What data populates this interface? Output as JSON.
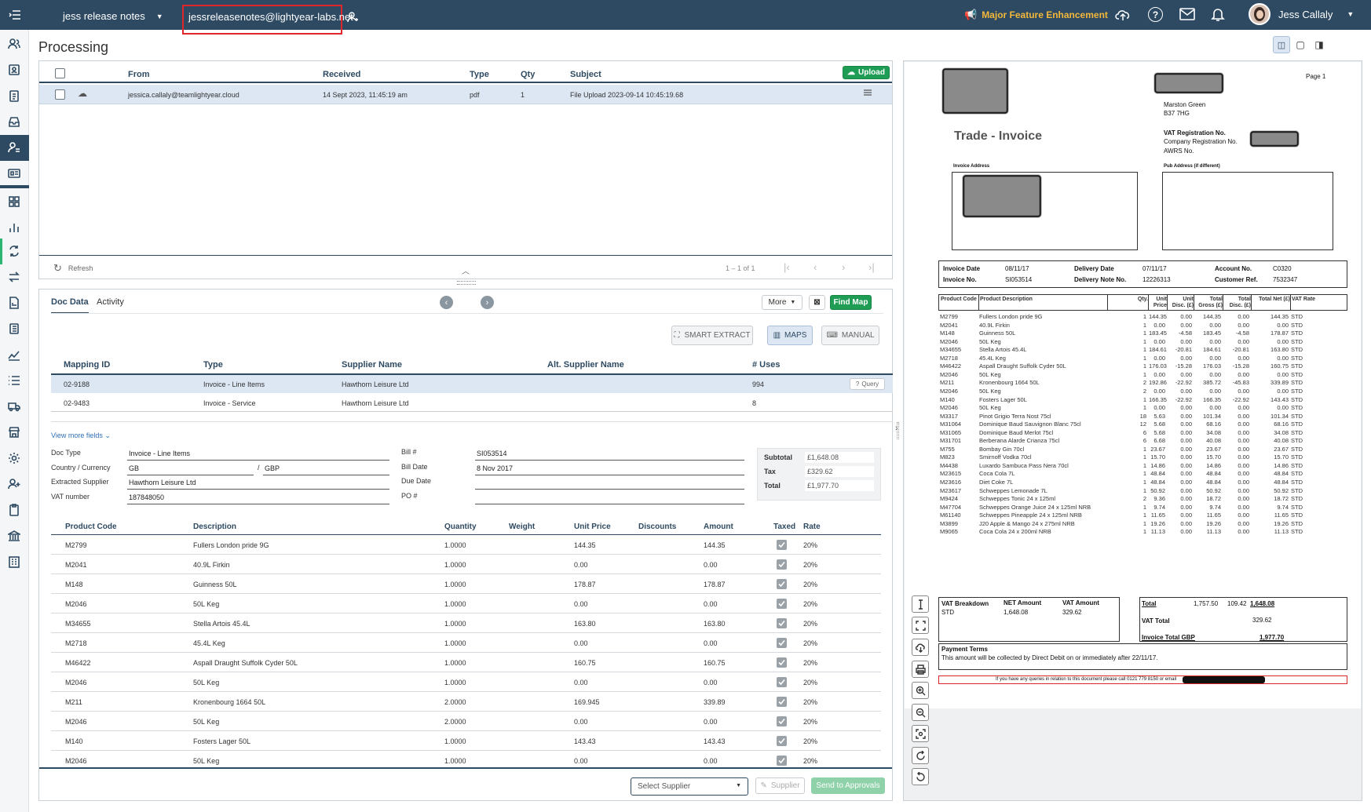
{
  "topbar": {
    "workspace": "jess release notes",
    "email": "jessreleasenotes@lightyear-labs.net",
    "feature": "Major Feature Enhancement",
    "user": "Jess Callaly"
  },
  "page_title": "Processing",
  "inbox": {
    "headers": {
      "from": "From",
      "received": "Received",
      "type": "Type",
      "qty": "Qty",
      "subject": "Subject"
    },
    "upload_label": "Upload",
    "row": {
      "from": "jessica.callaly@teamlightyear.cloud",
      "received": "14 Sept 2023, 11:45:19 am",
      "type": "pdf",
      "qty": "1",
      "subject": "File Upload 2023-09-14 10:45:19.68"
    },
    "refresh": "Refresh",
    "paging": "1 – 1 of 1"
  },
  "tabs": {
    "doc_data": "Doc Data",
    "activity": "Activity"
  },
  "buttons": {
    "more": "More",
    "find_map": "Find Map",
    "smart_extract": "SMART EXTRACT",
    "maps": "MAPS",
    "manual": "MANUAL",
    "query": "Query",
    "view_more": "View more fields",
    "select_supplier": "Select Supplier",
    "supplier": "Supplier",
    "send": "Send to Approvals"
  },
  "mapping": {
    "headers": {
      "id": "Mapping ID",
      "type": "Type",
      "supplier": "Supplier Name",
      "alt": "Alt. Supplier Name",
      "uses": "# Uses"
    },
    "rows": [
      {
        "id": "02-9188",
        "type": "Invoice - Line Items",
        "supplier": "Hawthorn Leisure Ltd",
        "alt": "",
        "uses": "994"
      },
      {
        "id": "02-9483",
        "type": "Invoice - Service",
        "supplier": "Hawthorn Leisure Ltd",
        "alt": "",
        "uses": "8"
      }
    ]
  },
  "fields": {
    "doc_type_label": "Doc Type",
    "doc_type": "Invoice - Line Items",
    "country_label": "Country / Currency",
    "country": "GB",
    "slash": "/",
    "currency": "GBP",
    "supplier_label": "Extracted Supplier",
    "supplier": "Hawthorn Leisure Ltd",
    "vat_label": "VAT number",
    "vat": "187848050",
    "bill_no_label": "Bill #",
    "bill_no": "SI053514",
    "bill_date_label": "Bill Date",
    "bill_date": "8 Nov 2017",
    "due_label": "Due Date",
    "due": "",
    "po_label": "PO #",
    "po": "",
    "subtotal_label": "Subtotal",
    "subtotal": "£1,648.08",
    "tax_label": "Tax",
    "tax": "£329.62",
    "total_label": "Total",
    "total": "£1,977.70"
  },
  "lines": {
    "headers": {
      "code": "Product Code",
      "desc": "Description",
      "qty": "Quantity",
      "weight": "Weight",
      "price": "Unit Price",
      "disc": "Discounts",
      "amount": "Amount",
      "taxed": "Taxed",
      "rate": "Rate"
    },
    "rows": [
      {
        "code": "M2799",
        "desc": "Fullers London pride 9G",
        "qty": "1.0000",
        "price": "144.35",
        "amount": "144.35",
        "rate": "20%"
      },
      {
        "code": "M2041",
        "desc": "40.9L Firkin",
        "qty": "1.0000",
        "price": "0.00",
        "amount": "0.00",
        "rate": "20%"
      },
      {
        "code": "M148",
        "desc": "Guinness 50L",
        "qty": "1.0000",
        "price": "178.87",
        "amount": "178.87",
        "rate": "20%"
      },
      {
        "code": "M2046",
        "desc": "50L Keg",
        "qty": "1.0000",
        "price": "0.00",
        "amount": "0.00",
        "rate": "20%"
      },
      {
        "code": "M34655",
        "desc": "Stella Artois 45.4L",
        "qty": "1.0000",
        "price": "163.80",
        "amount": "163.80",
        "rate": "20%"
      },
      {
        "code": "M2718",
        "desc": "45.4L Keg",
        "qty": "1.0000",
        "price": "0.00",
        "amount": "0.00",
        "rate": "20%"
      },
      {
        "code": "M46422",
        "desc": "Aspall Draught Suffolk Cyder 50L",
        "qty": "1.0000",
        "price": "160.75",
        "amount": "160.75",
        "rate": "20%"
      },
      {
        "code": "M2046",
        "desc": "50L Keg",
        "qty": "1.0000",
        "price": "0.00",
        "amount": "0.00",
        "rate": "20%"
      },
      {
        "code": "M211",
        "desc": "Kronenbourg 1664 50L",
        "qty": "2.0000",
        "price": "169.945",
        "amount": "339.89",
        "rate": "20%"
      },
      {
        "code": "M2046",
        "desc": "50L Keg",
        "qty": "2.0000",
        "price": "0.00",
        "amount": "0.00",
        "rate": "20%"
      },
      {
        "code": "M140",
        "desc": "Fosters Lager 50L",
        "qty": "1.0000",
        "price": "143.43",
        "amount": "143.43",
        "rate": "20%"
      },
      {
        "code": "M2046",
        "desc": "50L Keg",
        "qty": "1.0000",
        "price": "0.00",
        "amount": "0.00",
        "rate": "20%"
      }
    ]
  },
  "invoice": {
    "page": "Page  1",
    "addr1": "Marston Green",
    "addr2": "B37 7HG",
    "title": "Trade - Invoice",
    "vat_reg": "VAT Registration No.",
    "company_reg": "Company Registration No.",
    "awrs": "AWRS No.",
    "invoice_address": "Invoice Address",
    "pub_address": "Pub Address (if different)",
    "meta": {
      "inv_date_l": "Invoice Date",
      "inv_date": "08/11/17",
      "deliv_date_l": "Delivery Date",
      "deliv_date": "07/11/17",
      "acct_l": "Account No.",
      "acct": "C0320",
      "inv_no_l": "Invoice No.",
      "inv_no": "SI053514",
      "deliv_note_l": "Delivery Note No.",
      "deliv_note": "12226313",
      "cust_ref_l": "Customer Ref.",
      "cust_ref": "7532347"
    },
    "cols": [
      "Product Code",
      "Product Description",
      "Qty.",
      "Unit Price",
      "Unit Disc. (£)",
      "Total Gross (£)",
      "Total Disc. (£)",
      "Total Net (£)",
      "VAT Rate"
    ],
    "items": [
      [
        "M2799",
        "Fullers London pride 9G",
        "1",
        "144.35",
        "0.00",
        "144.35",
        "0.00",
        "144.35",
        "STD"
      ],
      [
        "M2041",
        "40.9L Firkin",
        "1",
        "0.00",
        "0.00",
        "0.00",
        "0.00",
        "0.00",
        "STD"
      ],
      [
        "M148",
        "Guinness  50L",
        "1",
        "183.45",
        "-4.58",
        "183.45",
        "-4.58",
        "178.87",
        "STD"
      ],
      [
        "M2046",
        "50L Keg",
        "1",
        "0.00",
        "0.00",
        "0.00",
        "0.00",
        "0.00",
        "STD"
      ],
      [
        "M34655",
        "Stella Artois  45.4L",
        "1",
        "184.61",
        "-20.81",
        "184.61",
        "-20.81",
        "163.80",
        "STD"
      ],
      [
        "M2718",
        "45.4L Keg",
        "1",
        "0.00",
        "0.00",
        "0.00",
        "0.00",
        "0.00",
        "STD"
      ],
      [
        "M46422",
        "Aspall Draught Suffolk Cyder 50L",
        "1",
        "176.03",
        "-15.28",
        "176.03",
        "-15.28",
        "160.75",
        "STD"
      ],
      [
        "M2046",
        "50L Keg",
        "1",
        "0.00",
        "0.00",
        "0.00",
        "0.00",
        "0.00",
        "STD"
      ],
      [
        "M211",
        "Kronenbourg 1664  50L",
        "2",
        "192.86",
        "-22.92",
        "385.72",
        "-45.83",
        "339.89",
        "STD"
      ],
      [
        "M2046",
        "50L Keg",
        "2",
        "0.00",
        "0.00",
        "0.00",
        "0.00",
        "0.00",
        "STD"
      ],
      [
        "M140",
        "Fosters Lager  50L",
        "1",
        "166.35",
        "-22.92",
        "166.35",
        "-22.92",
        "143.43",
        "STD"
      ],
      [
        "M2046",
        "50L Keg",
        "1",
        "0.00",
        "0.00",
        "0.00",
        "0.00",
        "0.00",
        "STD"
      ],
      [
        "M3317",
        "Pinot Grigio Terra Nost  75cl",
        "18",
        "5.63",
        "0.00",
        "101.34",
        "0.00",
        "101.34",
        "STD"
      ],
      [
        "M31064",
        "Dominique Baud Sauvignon Blanc  75cl",
        "12",
        "5.68",
        "0.00",
        "68.16",
        "0.00",
        "68.16",
        "STD"
      ],
      [
        "M31065",
        "Dominique Baud Merlot  75cl",
        "6",
        "5.68",
        "0.00",
        "34.08",
        "0.00",
        "34.08",
        "STD"
      ],
      [
        "M31701",
        "Berberana Alarde Crianza  75cl",
        "6",
        "6.68",
        "0.00",
        "40.08",
        "0.00",
        "40.08",
        "STD"
      ],
      [
        "M755",
        "Bombay Gin  70cl",
        "1",
        "23.67",
        "0.00",
        "23.67",
        "0.00",
        "23.67",
        "STD"
      ],
      [
        "M823",
        "Smirnoff Vodka  70cl",
        "1",
        "15.70",
        "0.00",
        "15.70",
        "0.00",
        "15.70",
        "STD"
      ],
      [
        "M4438",
        "Luxardo Sambuca Pass Nera  70cl",
        "1",
        "14.86",
        "0.00",
        "14.86",
        "0.00",
        "14.86",
        "STD"
      ],
      [
        "M23615",
        "Coca Cola  7L",
        "1",
        "48.84",
        "0.00",
        "48.84",
        "0.00",
        "48.84",
        "STD"
      ],
      [
        "M23616",
        "Diet Coke  7L",
        "1",
        "48.84",
        "0.00",
        "48.84",
        "0.00",
        "48.84",
        "STD"
      ],
      [
        "M23617",
        "Schweppes Lemonade  7L",
        "1",
        "50.92",
        "0.00",
        "50.92",
        "0.00",
        "50.92",
        "STD"
      ],
      [
        "M9424",
        "Schweppes Tonic 24 x 125ml",
        "2",
        "9.36",
        "0.00",
        "18.72",
        "0.00",
        "18.72",
        "STD"
      ],
      [
        "M47704",
        "Schweppes Orange Juice  24 x 125ml NRB",
        "1",
        "9.74",
        "0.00",
        "9.74",
        "0.00",
        "9.74",
        "STD"
      ],
      [
        "M61140",
        "Schweppes Pineapple  24 x 125ml NRB",
        "1",
        "11.65",
        "0.00",
        "11.65",
        "0.00",
        "11.65",
        "STD"
      ],
      [
        "M3899",
        "J20 Apple & Mango  24 x 275ml NRB",
        "1",
        "19.26",
        "0.00",
        "19.26",
        "0.00",
        "19.26",
        "STD"
      ],
      [
        "M9065",
        "Coca Cola 24 x 200ml NRB",
        "1",
        "11.13",
        "0.00",
        "11.13",
        "0.00",
        "11.13",
        "STD"
      ]
    ],
    "vat_breakdown": "VAT Breakdown",
    "net_amount": "NET Amount",
    "vat_amount": "VAT Amount",
    "std": "STD",
    "std_net": "1,648.08",
    "std_vat": "329.62",
    "total_l": "Total",
    "total_a": "1,757.50",
    "total_b": "109.42",
    "total_c": "1,648.08",
    "vat_total_l": "VAT Total",
    "vat_total": "329.62",
    "inv_total_l": "Invoice Total GBP",
    "inv_total": "1,977.70",
    "pay_terms_l": "Payment Terms",
    "pay_terms": "This amount will be collected by Direct Debit  on or immediately after 22/11/17.",
    "queries": "If you have any queries in relation to this document please call 0121 779 8150 or email"
  }
}
